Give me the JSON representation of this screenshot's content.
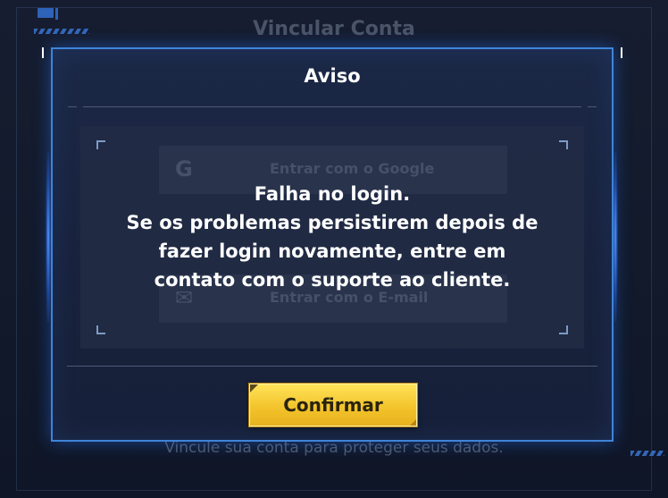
{
  "background": {
    "title": "Vincular Conta",
    "footer": "Vincule sua conta para proteger seus dados.",
    "google_option": "Entrar com o Google",
    "email_option": "Entrar com o E-mail"
  },
  "dialog": {
    "title": "Aviso",
    "message_lines": [
      "Falha no login.",
      "Se os problemas persistirem depois de",
      "fazer login novamente, entre em",
      "contato com o suporte ao cliente."
    ],
    "confirm_label": "Confirmar"
  },
  "colors": {
    "accent_border": "#3f84d8",
    "button_gold": "#f3c42c",
    "text": "#ffffff"
  }
}
